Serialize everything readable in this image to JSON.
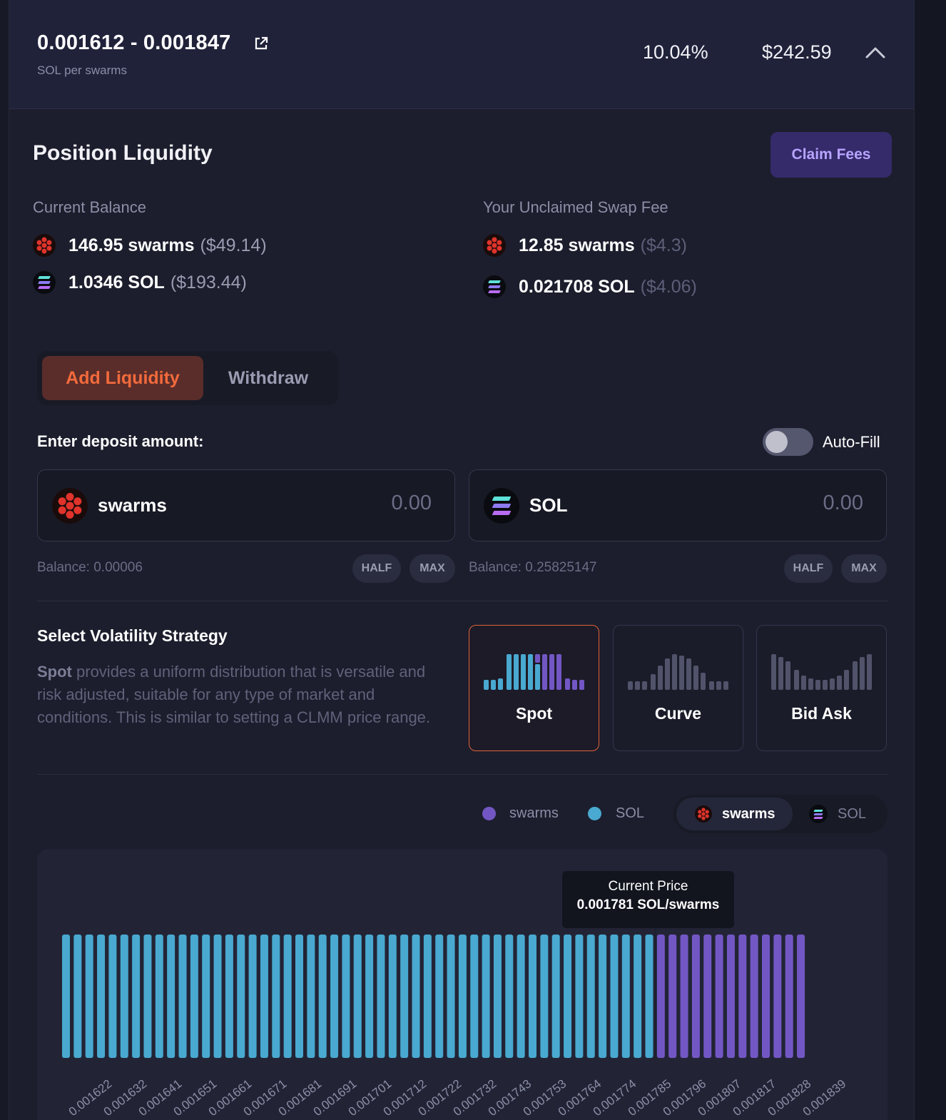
{
  "header": {
    "range": "0.001612 - 0.001847",
    "unit": "SOL per swarms",
    "apr": "10.04%",
    "total_usd": "$242.59"
  },
  "position": {
    "title": "Position Liquidity",
    "claim_label": "Claim Fees",
    "current_balance": {
      "label": "Current Balance",
      "swarms_amount": "146.95 swarms",
      "swarms_usd": "($49.14)",
      "sol_amount": "1.0346 SOL",
      "sol_usd": "($193.44)"
    },
    "unclaimed": {
      "label": "Your Unclaimed Swap Fee",
      "swarms_amount": "12.85 swarms",
      "swarms_usd": "($4.3)",
      "sol_amount": "0.021708 SOL",
      "sol_usd": "($4.06)"
    }
  },
  "tabs": {
    "add": "Add Liquidity",
    "withdraw": "Withdraw"
  },
  "deposit": {
    "label": "Enter deposit amount:",
    "autofill_label": "Auto-Fill",
    "autofill_on": false,
    "swarms": {
      "name": "swarms",
      "placeholder": "0.00",
      "balance": "Balance: 0.00006"
    },
    "sol": {
      "name": "SOL",
      "placeholder": "0.00",
      "balance": "Balance: 0.25825147"
    },
    "half": "HALF",
    "max": "MAX"
  },
  "strategy": {
    "title": "Select Volatility Strategy",
    "desc_strong": "Spot",
    "desc_rest": " provides a uniform distribution that is versatile and risk adjusted, suitable for any type of market and conditions. This is similar to setting a CLMM price range.",
    "options": [
      "Spot",
      "Curve",
      "Bid Ask"
    ],
    "selected": "Spot"
  },
  "legend": {
    "swarms": "swarms",
    "sol": "SOL",
    "toggle_active": "swarms",
    "toggle_inactive": "SOL"
  },
  "colors": {
    "swarms_bar": "#7257c4",
    "sol_bar": "#49a9d0",
    "accent": "#e0633a",
    "claim": "#b8a4ff"
  },
  "chart_data": {
    "type": "bar",
    "tooltip_title": "Current Price",
    "tooltip_value": "0.001781 SOL/swarms",
    "current_price": 0.001781,
    "bin_count": 64,
    "sol_bins": 51,
    "swarms_bins": 13,
    "tick_labels": [
      "0.001622",
      "0.001632",
      "0.001641",
      "0.001651",
      "0.001661",
      "0.001671",
      "0.001681",
      "0.001691",
      "0.001701",
      "0.001712",
      "0.001722",
      "0.001732",
      "0.001743",
      "0.001753",
      "0.001764",
      "0.001774",
      "0.001785",
      "0.001796",
      "0.001807",
      "0.001817",
      "0.001828",
      "0.001839"
    ],
    "series": [
      {
        "name": "SOL",
        "color": "#49a9d0",
        "relative_height": 1.0
      },
      {
        "name": "swarms",
        "color": "#7257c4",
        "relative_height": 1.0
      }
    ],
    "grid": false,
    "legend": "top-right"
  }
}
